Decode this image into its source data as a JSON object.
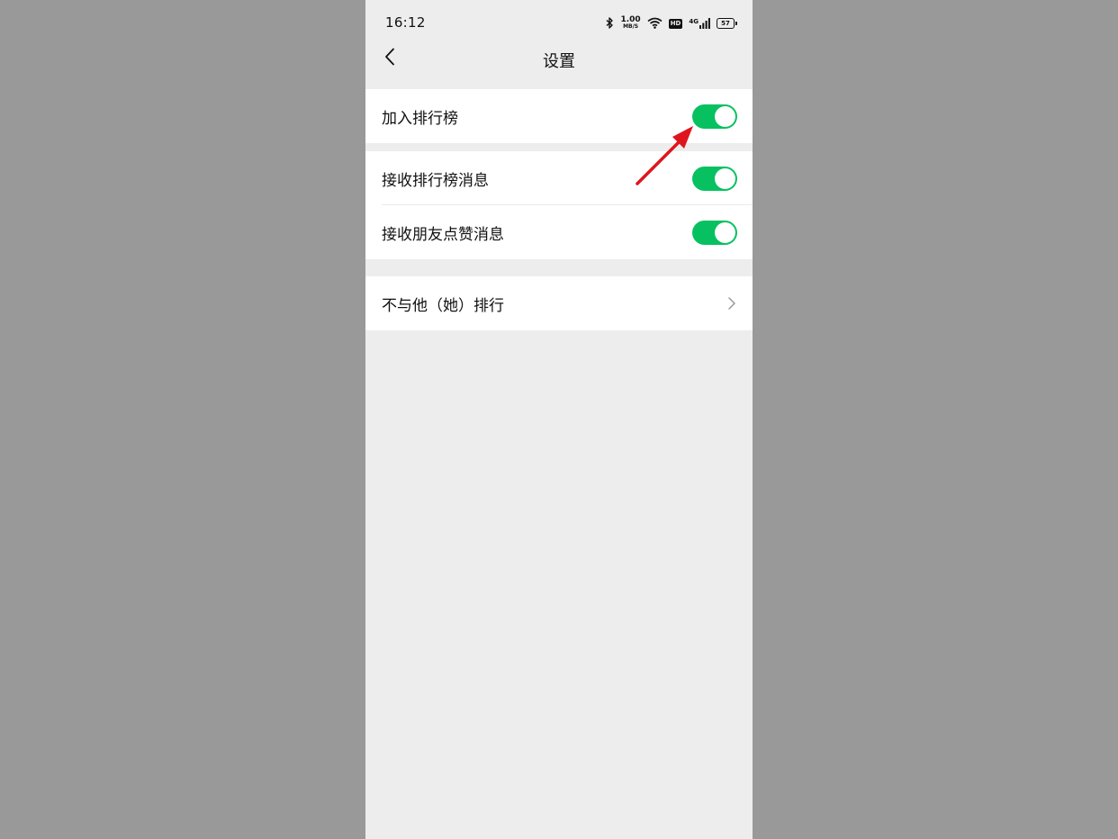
{
  "status_bar": {
    "time": "16:12",
    "net_speed_value": "1.00",
    "net_speed_unit": "MB/S",
    "hd_badge": "HD",
    "signal_type": "4G",
    "battery_level": "57"
  },
  "nav": {
    "title": "设置"
  },
  "settings": {
    "join_leaderboard": {
      "label": "加入排行榜",
      "enabled": true
    },
    "receive_leaderboard_messages": {
      "label": "接收排行榜消息",
      "enabled": true
    },
    "receive_friend_like_messages": {
      "label": "接收朋友点赞消息",
      "enabled": true
    },
    "exclude_from_ranking": {
      "label": "不与他（她）排行"
    }
  },
  "colors": {
    "toggle_on": "#07c160",
    "annotation_arrow": "#e0141c",
    "page_background": "#ededed",
    "outer_background": "#999999"
  },
  "icons": {
    "back": "back-chevron-icon",
    "row_nav": "chevron-right-icon",
    "bluetooth": "bluetooth-icon",
    "wifi": "wifi-icon",
    "signal": "cellular-signal-icon",
    "battery": "battery-icon"
  }
}
